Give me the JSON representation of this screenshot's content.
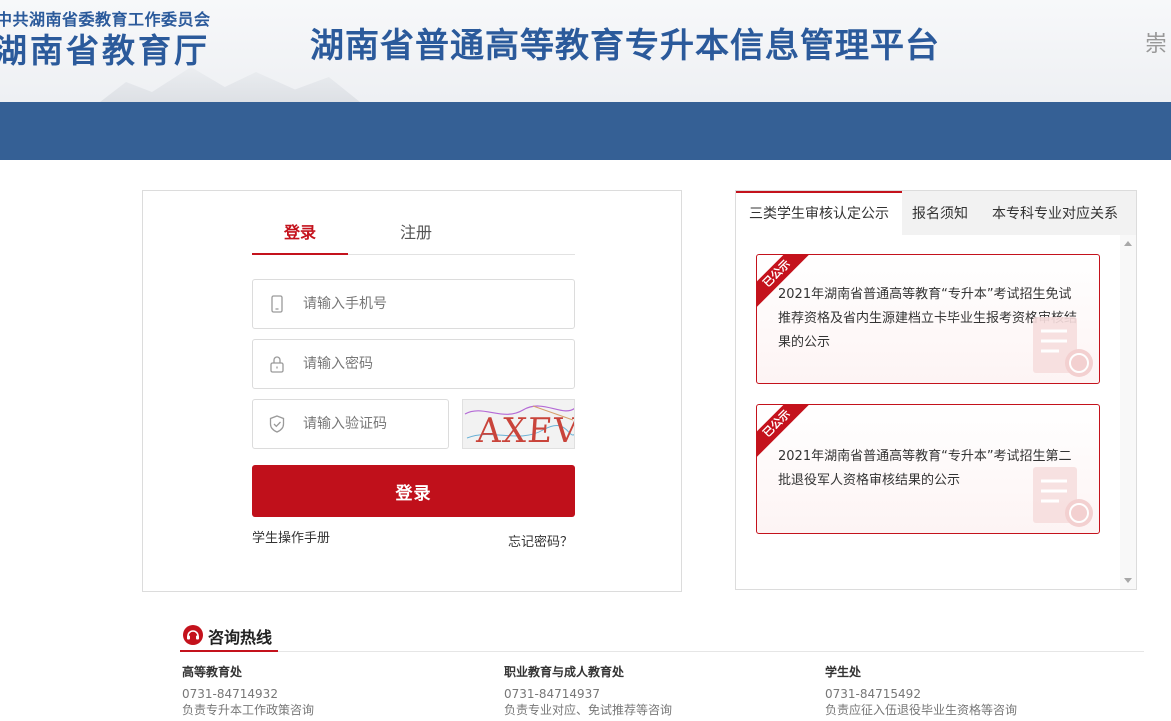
{
  "header": {
    "org_line1": "中共湖南省委教育工作委员会",
    "org_line2": "湖南省教育厅",
    "platform_title": "湖南省普通高等教育专升本信息管理平台",
    "corner_char": "崇"
  },
  "login": {
    "tabs": [
      {
        "label": "登录",
        "active": true
      },
      {
        "label": "注册",
        "active": false
      }
    ],
    "phone_placeholder": "请输入手机号",
    "password_placeholder": "请输入密码",
    "captcha_placeholder": "请输入验证码",
    "captcha_text": "AXEV",
    "submit_label": "登录",
    "manual_link": "学生操作手册",
    "forgot_link": "忘记密码？"
  },
  "notices": {
    "tabs": [
      {
        "label": "三类学生审核认定公示",
        "active": true
      },
      {
        "label": "报名须知",
        "active": false
      },
      {
        "label": "本专科专业对应关系",
        "active": false
      }
    ],
    "items": [
      {
        "badge": "已公示",
        "text": "2021年湖南省普通高等教育“专升本”考试招生免试推荐资格及省内生源建档立卡毕业生报考资格审核结果的公示"
      },
      {
        "badge": "已公示",
        "text": "2021年湖南省普通高等教育“专升本”考试招生第二批退役军人资格审核结果的公示"
      }
    ]
  },
  "hotline": {
    "title": "咨询热线",
    "departments": [
      {
        "name": "高等教育处",
        "phone": "0731-84714932",
        "desc": "负责专升本工作政策咨询"
      },
      {
        "name": "职业教育与成人教育处",
        "phone": "0731-84714937",
        "desc": "负责专业对应、免试推荐等咨询"
      },
      {
        "name": "学生处",
        "phone": "0731-84715492",
        "desc": "负责应征入伍退役毕业生资格等咨询"
      }
    ]
  },
  "colors": {
    "brand_blue": "#356095",
    "title_blue": "#2b5a9b",
    "accent_red": "#c4121c"
  }
}
